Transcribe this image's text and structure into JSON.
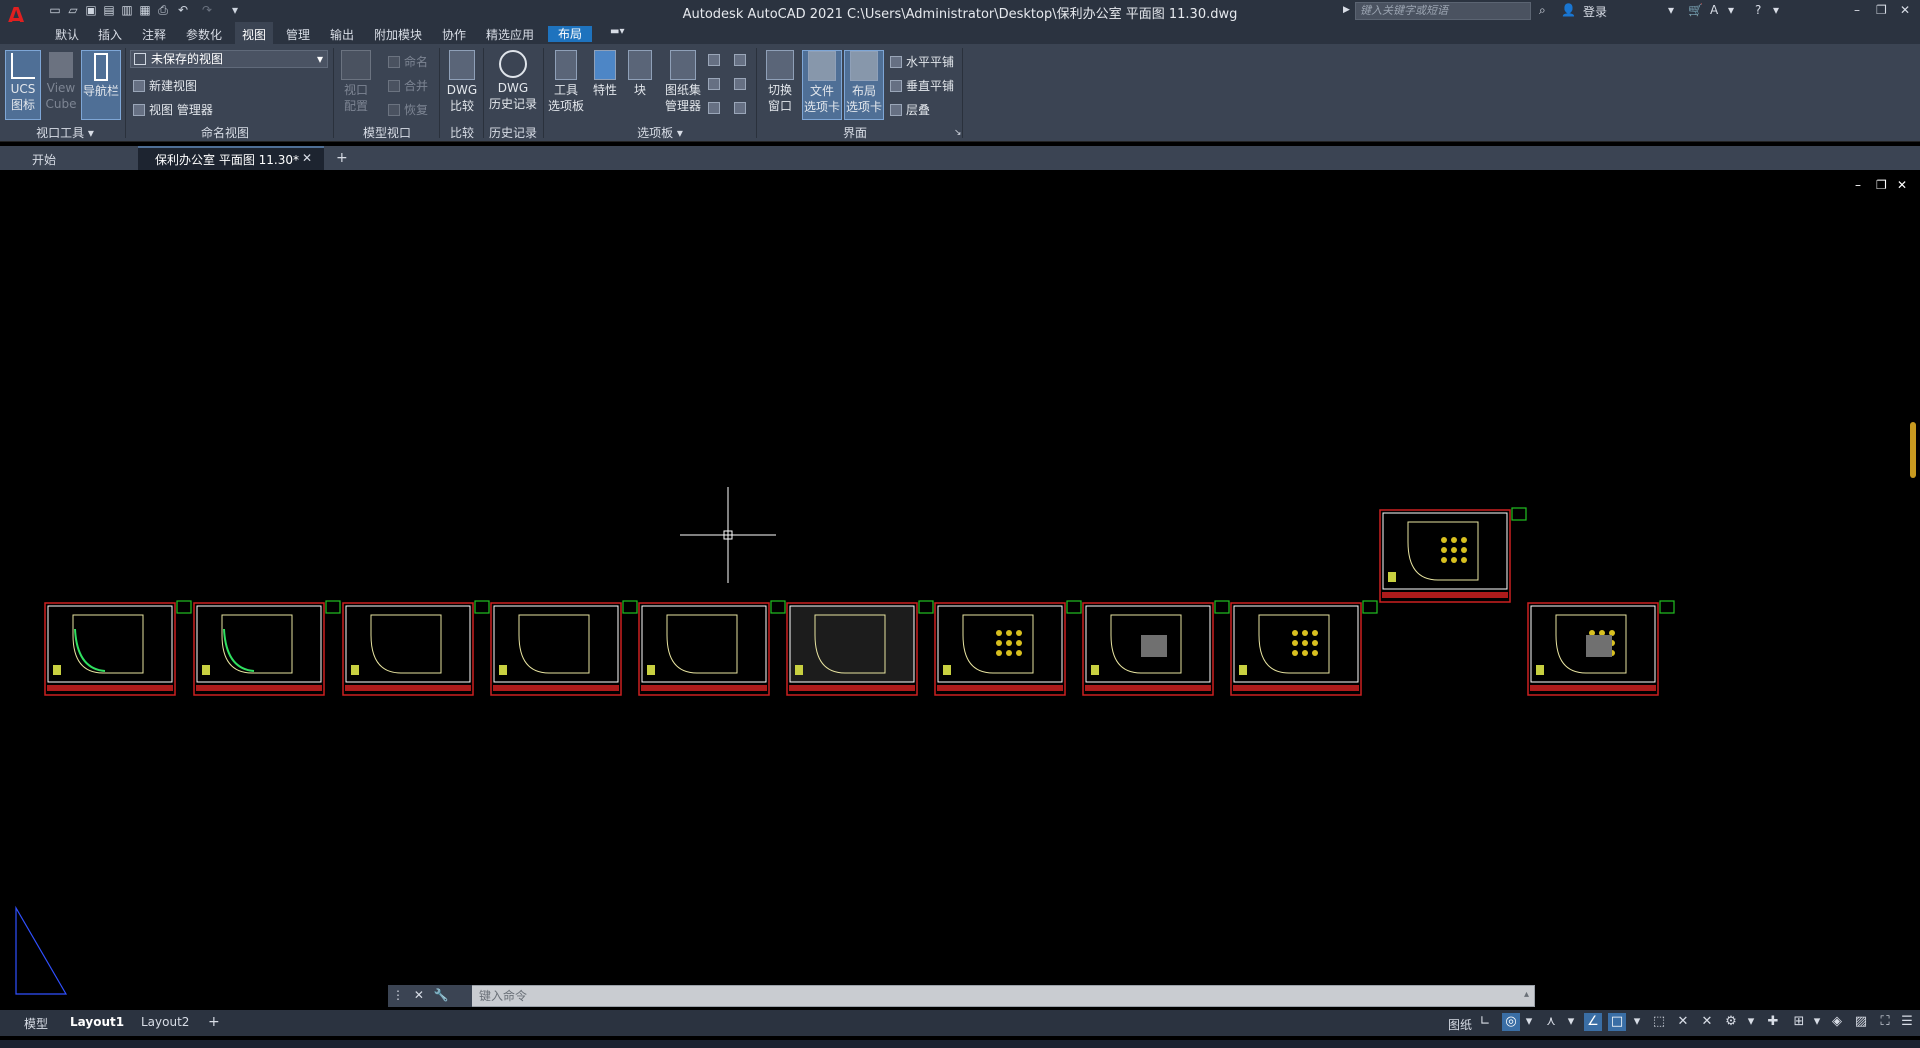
{
  "title_bar": {
    "logo": "A",
    "window_title": "Autodesk AutoCAD 2021    C:\\Users\\Administrator\\Desktop\\保利办公室 平面图 11.30.dwg",
    "search_placeholder": "键入关键字或短语",
    "login": "登录"
  },
  "ribbon_tabs": [
    "默认",
    "插入",
    "注释",
    "参数化",
    "视图",
    "管理",
    "输出",
    "附加模块",
    "协作",
    "精选应用",
    "布局"
  ],
  "ribbon": {
    "ucs": "UCS\n图标",
    "viewcube": "View\nCube",
    "navbar": "导航栏",
    "views_dropdown": "未保存的视图",
    "new_view": "新建视图",
    "view_manager": "视图 管理器",
    "viewport_config": "视口\n配置",
    "vp_name": "命名",
    "vp_join": "合并",
    "vp_restore": "恢复",
    "dwg_compare": "DWG\n比较",
    "dwg_history": "DWG\n历史记录",
    "tool_palette": "工具\n选项板",
    "properties": "特性",
    "block": "块",
    "sheetset": "图纸集\n管理器",
    "switch_window": "切换\n窗口",
    "file_tabs": "文件\n选项卡",
    "layout_tabs": "布局\n选项卡",
    "tile_h": "水平平铺",
    "tile_v": "垂直平铺",
    "cascade": "层叠",
    "panel_labels": {
      "viewport_tools": "视口工具",
      "named_views": "命名视图",
      "model_viewports": "模型视口",
      "compare": "比较",
      "history": "历史记录",
      "palettes": "选项板",
      "interface": "界面"
    }
  },
  "doc_tabs": {
    "start": "开始",
    "active": "保利办公室 平面图 11.30*"
  },
  "command_line": {
    "placeholder": "键入命令"
  },
  "layout_tabs": [
    "模型",
    "Layout1",
    "Layout2"
  ],
  "status": {
    "paper": "图纸"
  },
  "colors": {
    "accent": "#1e73be",
    "sheet_border": "#cc2020",
    "viewport_marker": "#22c022",
    "canvas": "#000000"
  }
}
